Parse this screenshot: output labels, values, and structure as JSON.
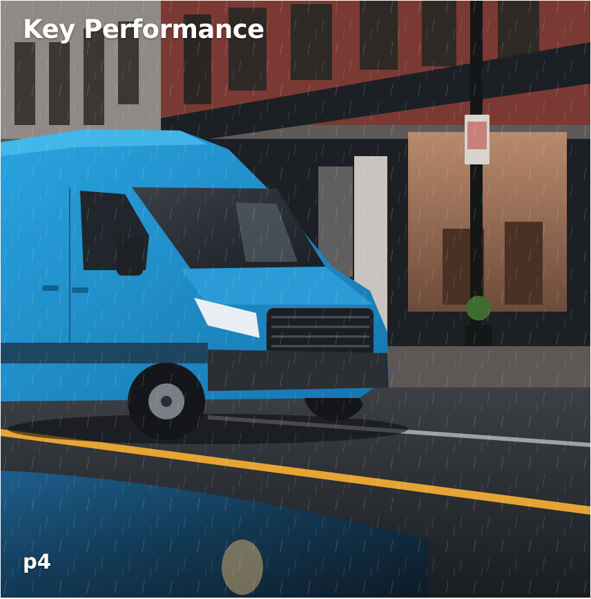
{
  "slide": {
    "title": "Key Performance",
    "page_label": "p4"
  },
  "photo": {
    "subject": "blue-delivery-van",
    "setting": "rainy-city-street",
    "colors": {
      "van": "#2a9bd6",
      "road_stripe": "#e6a532",
      "brick": "#7a3a33",
      "storefront": "#1c2024"
    }
  }
}
